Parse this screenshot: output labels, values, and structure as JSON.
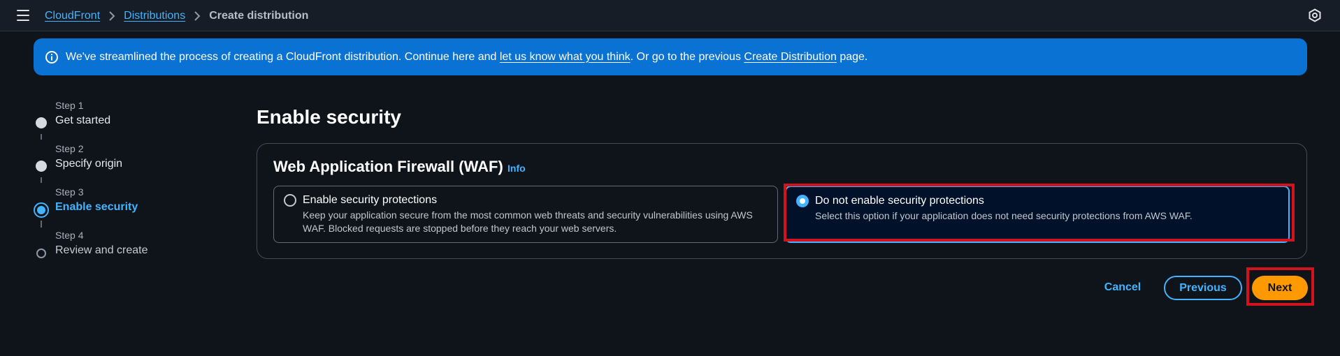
{
  "breadcrumb": {
    "items": [
      "CloudFront",
      "Distributions"
    ],
    "current": "Create distribution"
  },
  "icons": {
    "menu": "hamburger-menu-icon",
    "top_right": "settings-hexagon-icon",
    "info": "info-circle-icon",
    "breadcrumb_separator": "chevron-right-icon"
  },
  "flash": {
    "text_1": "We've streamlined the process of creating a CloudFront distribution. Continue here and ",
    "link_1": "let us know what you think",
    "text_2": ". Or go to the previous ",
    "link_2": "Create Distribution",
    "text_3": " page."
  },
  "steps": [
    {
      "num": "Step 1",
      "label": "Get started",
      "state": "completed"
    },
    {
      "num": "Step 2",
      "label": "Specify origin",
      "state": "completed"
    },
    {
      "num": "Step 3",
      "label": "Enable security",
      "state": "active"
    },
    {
      "num": "Step 4",
      "label": "Review and create",
      "state": "upcoming"
    }
  ],
  "main": {
    "title": "Enable security",
    "container_title": "Web Application Firewall (WAF)",
    "info_link": "Info",
    "options": [
      {
        "title": "Enable security protections",
        "description": "Keep your application secure from the most common web threats and security vulnerabilities using AWS WAF. Blocked requests are stopped before they reach your web servers.",
        "selected": false
      },
      {
        "title": "Do not enable security protections",
        "description": "Select this option if your application does not need security protections from AWS WAF.",
        "selected": true
      }
    ]
  },
  "actions": {
    "cancel": "Cancel",
    "previous": "Previous",
    "next": "Next"
  },
  "colors": {
    "accent": "#42b4ff",
    "primary_button": "#ff9900",
    "flash_bg": "#0972d3",
    "highlight": "#d3121c",
    "background": "#0f141a"
  }
}
